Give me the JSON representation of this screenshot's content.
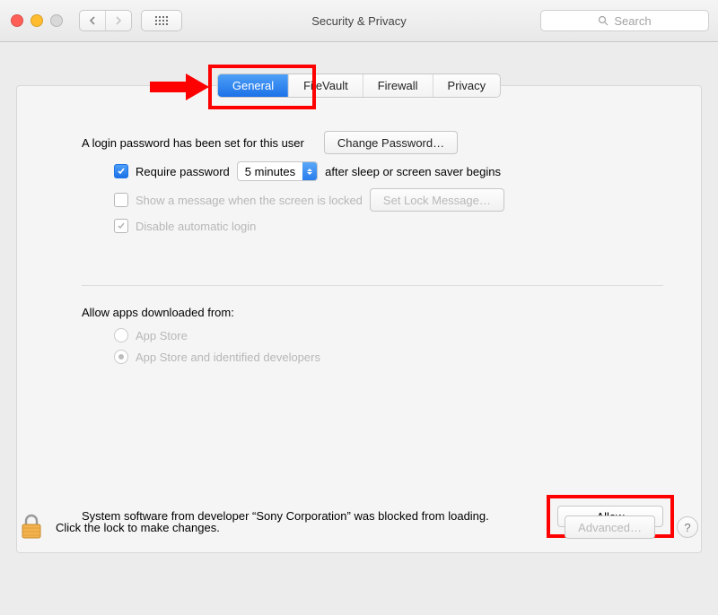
{
  "window": {
    "title": "Security & Privacy"
  },
  "search": {
    "placeholder": "Search"
  },
  "tabs": {
    "general": "General",
    "filevault": "FileVault",
    "firewall": "Firewall",
    "privacy": "Privacy"
  },
  "general": {
    "login_password_set": "A login password has been set for this user",
    "change_password": "Change Password…",
    "require_password": "Require password",
    "delay_value": "5 minutes",
    "after_sleep": "after sleep or screen saver begins",
    "show_message": "Show a message when the screen is locked",
    "set_lock_message": "Set Lock Message…",
    "disable_auto_login": "Disable automatic login",
    "allow_apps_heading": "Allow apps downloaded from:",
    "opt_app_store": "App Store",
    "opt_identified": "App Store and identified developers",
    "blocked_text": "System software from developer “Sony Corporation” was blocked from loading.",
    "allow": "Allow"
  },
  "footer": {
    "lock_text": "Click the lock to make changes.",
    "advanced": "Advanced…"
  }
}
